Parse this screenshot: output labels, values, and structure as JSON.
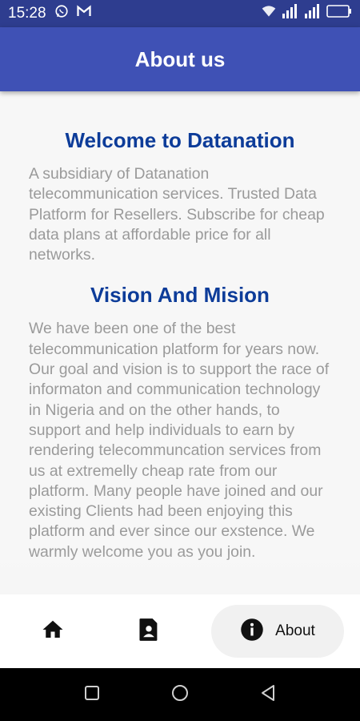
{
  "status_bar": {
    "time": "15:28",
    "icons": [
      "whatsapp-icon",
      "gmail-icon",
      "wifi-icon",
      "signal-icon",
      "signal-icon",
      "battery-icon"
    ]
  },
  "app_bar": {
    "title": "About us"
  },
  "content": {
    "welcome_heading": "Welcome to Datanation",
    "welcome_text": "A subsidiary of Datanation telecommunication services. Trusted Data Platform for Resellers. Subscribe for cheap data plans at affordable price for all networks.",
    "vision_heading": "Vision And Mision",
    "vision_text": "We have been one of the best telecommunication platform for years now. Our goal and vision is to support the race of informaton and communication technology in Nigeria and on the other hands, to support and help individuals to earn by rendering telecommuncation services from us at extremelly cheap rate from our platform. Many people have joined and our existing Clients had been enjoying this platform and ever since our exstence. We warmly welcome you as you join."
  },
  "bottom_nav": {
    "items": [
      {
        "icon": "home-icon",
        "label": ""
      },
      {
        "icon": "contact-icon",
        "label": ""
      },
      {
        "icon": "info-icon",
        "label": "About",
        "selected": true
      }
    ]
  },
  "colors": {
    "status_bar": "#2e3d8f",
    "app_bar": "#3f51b5",
    "heading": "#0d3c99",
    "body_text": "#9a9a9a"
  }
}
